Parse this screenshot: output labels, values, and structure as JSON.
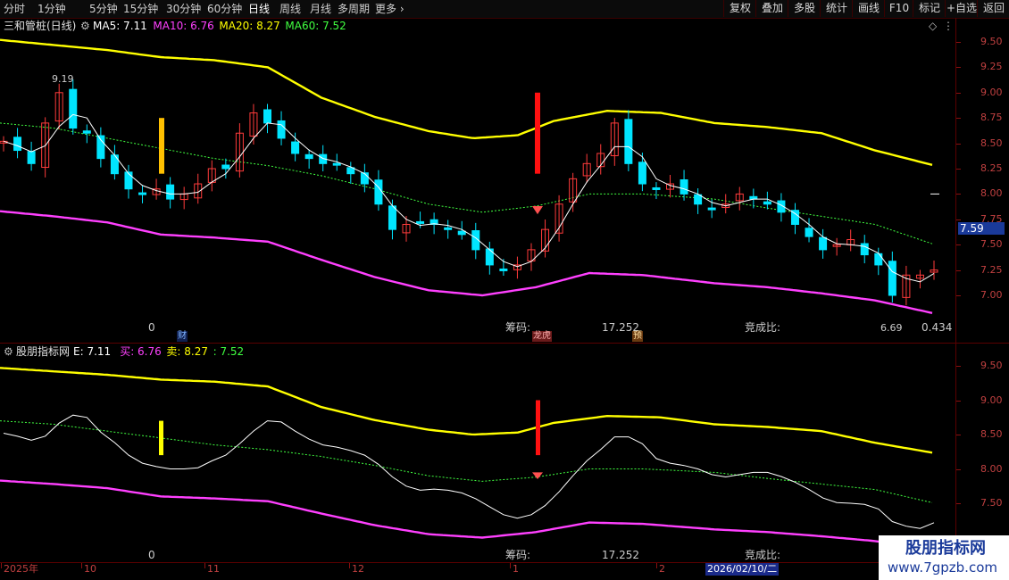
{
  "toolbar": {
    "timeframes": [
      "分时",
      "1分钟",
      "5分钟",
      "15分钟",
      "30分钟",
      "60分钟",
      "日线",
      "周线",
      "月线",
      "多周期",
      "更多"
    ],
    "active": "日线",
    "right_buttons": [
      "复权",
      "叠加",
      "多股",
      "统计",
      "画线",
      "F10",
      "标记",
      "+自选",
      "返回"
    ]
  },
  "main_panel": {
    "title": "三和管桩(日线)",
    "ma_labels": [
      {
        "text": "MA5: 7.11",
        "color": "#ffffff"
      },
      {
        "text": "MA10: 6.76",
        "color": "#ff40ff"
      },
      {
        "text": "MA20: 8.27",
        "color": "#ffff00"
      },
      {
        "text": "MA60: 7.52",
        "color": "#40ff40"
      }
    ],
    "price_ticks": [
      "9.50",
      "9.25",
      "9.00",
      "8.75",
      "8.50",
      "8.25",
      "8.00",
      "7.75",
      "7.50",
      "7.25",
      "7.00"
    ],
    "current_price": "7.59",
    "high_label": "9.19",
    "low_label": "6.69",
    "bottom_zero": "0",
    "chip_label": "筹码:",
    "chip_value": "17.252",
    "auction_label": "竞成比:",
    "auction_value": "0.434",
    "tag_cai": "财",
    "tag_bang": "龙虎",
    "tag_yu": "预"
  },
  "sub_panel": {
    "title": "股朋指标网",
    "labels": [
      {
        "text": "E: 7.11",
        "color": "#ffffff"
      },
      {
        "text": "买: 6.76",
        "color": "#ff40ff"
      },
      {
        "text": "卖: 8.27",
        "color": "#ffff00"
      },
      {
        "text": ": 7.52",
        "color": "#40ff40"
      }
    ],
    "price_ticks": [
      "9.50",
      "9.00",
      "8.50",
      "8.00",
      "7.50"
    ],
    "bottom_zero": "0",
    "chip_label": "筹码:",
    "chip_value": "17.252",
    "auction_label": "竞成比:"
  },
  "date_axis": {
    "labels": [
      "2025年",
      "10",
      "11",
      "12",
      "1",
      "2"
    ],
    "cursor_date": "2026/02/10/二"
  },
  "watermark": {
    "name": "股朋指标网",
    "url": "www.7gpzb.com"
  },
  "colors": {
    "up": "#ff3b3b",
    "down": "#00e5ff",
    "ma20": "#ffff00",
    "ma60": "#40ff40",
    "ma10": "#ff40ff",
    "ma5": "#ffffff"
  }
}
